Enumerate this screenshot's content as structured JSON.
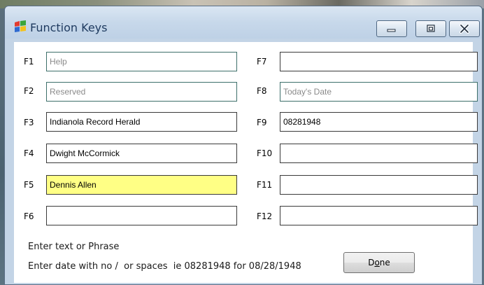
{
  "window": {
    "title": "Function Keys",
    "icon": "windows-flag-icon"
  },
  "caption_buttons": {
    "minimize_icon": "minimize-icon",
    "maximize_icon": "maximize-icon",
    "close_icon": "close-icon"
  },
  "keys": {
    "left": [
      {
        "key": "F1",
        "value": "Help",
        "enabled": false
      },
      {
        "key": "F2",
        "value": "Reserved",
        "enabled": false
      },
      {
        "key": "F3",
        "value": "Indianola Record Herald",
        "enabled": true
      },
      {
        "key": "F4",
        "value": "Dwight McCormick",
        "enabled": true
      },
      {
        "key": "F5",
        "value": "Dennis Allen",
        "enabled": true,
        "highlighted": true
      },
      {
        "key": "F6",
        "value": "",
        "enabled": true
      }
    ],
    "right": [
      {
        "key": "F7",
        "value": "",
        "enabled": true
      },
      {
        "key": "F8",
        "value": "Today's Date",
        "enabled": false
      },
      {
        "key": "F9",
        "value": "08281948",
        "enabled": true
      },
      {
        "key": "F10",
        "value": "",
        "enabled": true
      },
      {
        "key": "F11",
        "value": "",
        "enabled": true
      },
      {
        "key": "F12",
        "value": "",
        "enabled": true
      }
    ]
  },
  "hints": {
    "line1": "Enter text or Phrase",
    "line2": "Enter date with no /  or spaces  ie 08281948 for 08/28/1948"
  },
  "done_button": {
    "label_prefix": "D",
    "label_mnemonic": "o",
    "label_suffix": "ne"
  },
  "colors": {
    "highlight_field": "#ffff85",
    "disabled_border": "#3d6f6a",
    "window_frame": "#c3d4e6"
  }
}
